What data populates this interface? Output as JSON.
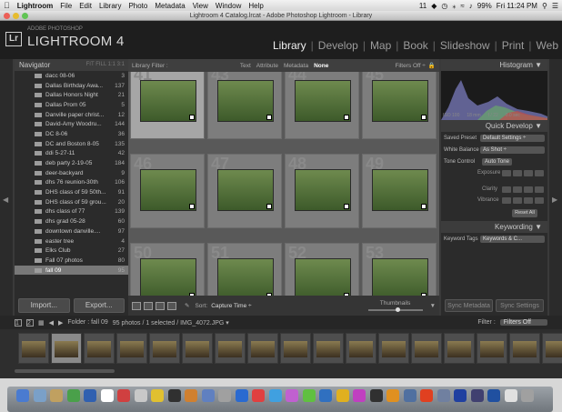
{
  "menubar": {
    "app_name": "Lightroom",
    "items": [
      "File",
      "Edit",
      "Library",
      "Photo",
      "Metadata",
      "View",
      "Window",
      "Help"
    ],
    "status": [
      "11",
      "99%",
      "Fri 11:24 PM"
    ]
  },
  "window": {
    "title": "Lightroom 4 Catalog.lrcat - Adobe Photoshop Lightroom - Library"
  },
  "identity": {
    "logo": "Lr",
    "small": "ADOBE PHOTOSHOP",
    "name": "LIGHTROOM 4"
  },
  "modules": [
    "Library",
    "Develop",
    "Map",
    "Book",
    "Slideshow",
    "Print",
    "Web"
  ],
  "navigator": {
    "label": "Navigator",
    "zoom": "FIT FILL 1:1 3:1"
  },
  "folders": [
    {
      "name": "dacc 08-06",
      "count": "3"
    },
    {
      "name": "Dallas Birthday Awa...",
      "count": "137"
    },
    {
      "name": "Dallas Honors Night",
      "count": "21"
    },
    {
      "name": "Dallas Prom 05",
      "count": "5"
    },
    {
      "name": "Danville paper christ...",
      "count": "12"
    },
    {
      "name": "David-Amy Woodru...",
      "count": "144"
    },
    {
      "name": "DC 8-06",
      "count": "36"
    },
    {
      "name": "DC and Boston 8-05",
      "count": "135"
    },
    {
      "name": "ddi 5-27-11",
      "count": "42"
    },
    {
      "name": "deb party 2-19-05",
      "count": "184"
    },
    {
      "name": "deer-backyard",
      "count": "9"
    },
    {
      "name": "dhs 76 reunion-30th",
      "count": "106"
    },
    {
      "name": "DHS class of 59 50th...",
      "count": "91"
    },
    {
      "name": "DHS class of 59 grou...",
      "count": "20"
    },
    {
      "name": "dhs class of 77",
      "count": "139"
    },
    {
      "name": "dhs grad 05-28",
      "count": "60"
    },
    {
      "name": "downtown danville....",
      "count": "97"
    },
    {
      "name": "easter tree",
      "count": "4"
    },
    {
      "name": "Elks Club",
      "count": "27"
    },
    {
      "name": "Fall 07 photos",
      "count": "80"
    },
    {
      "name": "fall 09",
      "count": "95"
    }
  ],
  "left_buttons": {
    "import": "Import...",
    "export": "Export..."
  },
  "filterbar": {
    "label": "Library Filter :",
    "tabs": [
      "Text",
      "Attribute",
      "Metadata",
      "None"
    ],
    "filters": "Filters Off ÷"
  },
  "grid_numbers": [
    "41",
    "43",
    "44",
    "45",
    "46",
    "47",
    "48",
    "49",
    "50",
    "51",
    "52",
    "53"
  ],
  "toolbar": {
    "sort_label": "Sort:",
    "sort_value": "Capture Time ÷",
    "thumbnails": "Thumbnails"
  },
  "right_panel": {
    "histogram": "Histogram",
    "histo_info": [
      "ISO 100",
      "18 mm",
      "f / 22",
      "0.0 sec"
    ],
    "quick_develop": "Quick Develop",
    "saved_preset_label": "Saved Preset",
    "saved_preset_value": "Default Settings ÷",
    "white_balance_label": "White Balance",
    "white_balance_value": "As Shot ÷",
    "tone_control_label": "Tone Control",
    "auto_tone": "Auto Tone",
    "exposure": "Exposure",
    "clarity": "Clarity",
    "vibrance": "Vibrance",
    "reset_all": "Reset All",
    "keywording": "Keywording",
    "keyword_tags_label": "Keyword Tags",
    "keyword_tags_value": "Keywords & C...",
    "sync_metadata": "Sync Metadata",
    "sync_settings": "Sync Settings"
  },
  "filmstrip": {
    "page1": "1",
    "page2": "2",
    "folder_label": "Folder : fall 09",
    "count": "95 photos / 1 selected / IMG_4072.JPG ▾",
    "filter_label": "Filter :",
    "filter_value": "Filters Off"
  },
  "colors": {
    "panel_bg": "#2b2b2b",
    "grid_bg": "#595959",
    "active_module": "#f0f0f0"
  }
}
